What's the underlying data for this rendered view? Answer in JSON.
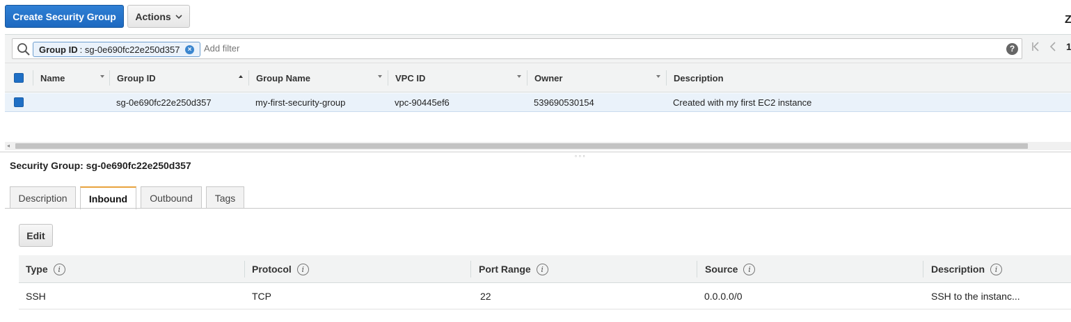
{
  "toolbar": {
    "create_label": "Create Security Group",
    "actions_label": "Actions",
    "corner_glyph": "Z"
  },
  "filter": {
    "token_key": "Group ID",
    "token_value": ": sg-0e690fc22e250d357",
    "placeholder": "Add filter",
    "help_glyph": "?",
    "page_number": "1"
  },
  "table": {
    "columns": [
      "Name",
      "Group ID",
      "Group Name",
      "VPC ID",
      "Owner",
      "Description"
    ],
    "rows": [
      {
        "name": "",
        "group_id": "sg-0e690fc22e250d357",
        "group_name": "my-first-security-group",
        "vpc_id": "vpc-90445ef6",
        "owner": "539690530154",
        "description": "Created with my first EC2 instance"
      }
    ]
  },
  "detail": {
    "title": "Security Group: sg-0e690fc22e250d357",
    "tabs": [
      "Description",
      "Inbound",
      "Outbound",
      "Tags"
    ],
    "active_tab": "Inbound",
    "edit_label": "Edit",
    "rules_columns": [
      "Type",
      "Protocol",
      "Port Range",
      "Source",
      "Description"
    ],
    "rules": [
      {
        "type": "SSH",
        "protocol": "TCP",
        "port_range": "22",
        "source": "0.0.0.0/0",
        "description": "SSH to the instanc..."
      }
    ]
  },
  "colors": {
    "primary": "#1d69c0",
    "selected_row": "#eaf2fa",
    "active_tab_accent": "#e8a33d"
  }
}
